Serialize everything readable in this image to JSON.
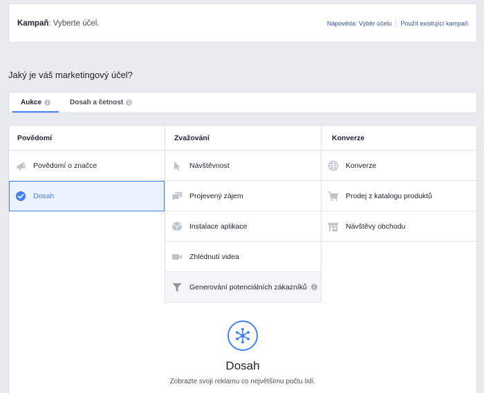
{
  "colors": {
    "page_bg": "#e9ebee",
    "accent": "#4080ff",
    "link": "#365899",
    "text": "#1d2129",
    "icon_gray": "#bec2c9",
    "selected_bg": "#ecf3ff",
    "highlight_bg": "#f5f6f7"
  },
  "header": {
    "title_label": "Kampaň",
    "title_value": ": Vyberte účel.",
    "help_link": "Nápověda: Výběr účelu",
    "existing_campaign_link": "Použít existující kampaň"
  },
  "question": "Jaký je váš marketingový účel?",
  "tabs": [
    {
      "label": "Aukce",
      "active": true,
      "icon": "info-icon"
    },
    {
      "label": "Dosah a četnost",
      "active": false,
      "icon": "info-icon"
    }
  ],
  "columns": [
    {
      "title": "Povědomí",
      "items": [
        {
          "label": "Povědomí o značce",
          "icon": "megaphone-icon"
        },
        {
          "label": "Dosah",
          "icon": "check-circle-icon",
          "selected": true
        }
      ]
    },
    {
      "title": "Zvažování",
      "items": [
        {
          "label": "Návštěvnost",
          "icon": "cursor-icon"
        },
        {
          "label": "Projevený zájem",
          "icon": "chat-bubbles-icon"
        },
        {
          "label": "Instalace aplikace",
          "icon": "box-icon"
        },
        {
          "label": "Zhlédnutí videa",
          "icon": "video-camera-icon"
        },
        {
          "label": "Generování potenciálních zákazníků",
          "icon": "funnel-icon",
          "info_icon": "info-icon",
          "highlighted": true
        }
      ]
    },
    {
      "title": "Konverze",
      "items": [
        {
          "label": "Konverze",
          "icon": "globe-icon"
        },
        {
          "label": "Prodej z katalogu produktů",
          "icon": "cart-icon"
        },
        {
          "label": "Návštěvy obchodu",
          "icon": "store-icon"
        }
      ]
    }
  ],
  "selected_objective": {
    "icon": "reach-icon",
    "title": "Dosah",
    "description": "Zobrazte svoji reklamu co největšímu počtu lidí."
  }
}
